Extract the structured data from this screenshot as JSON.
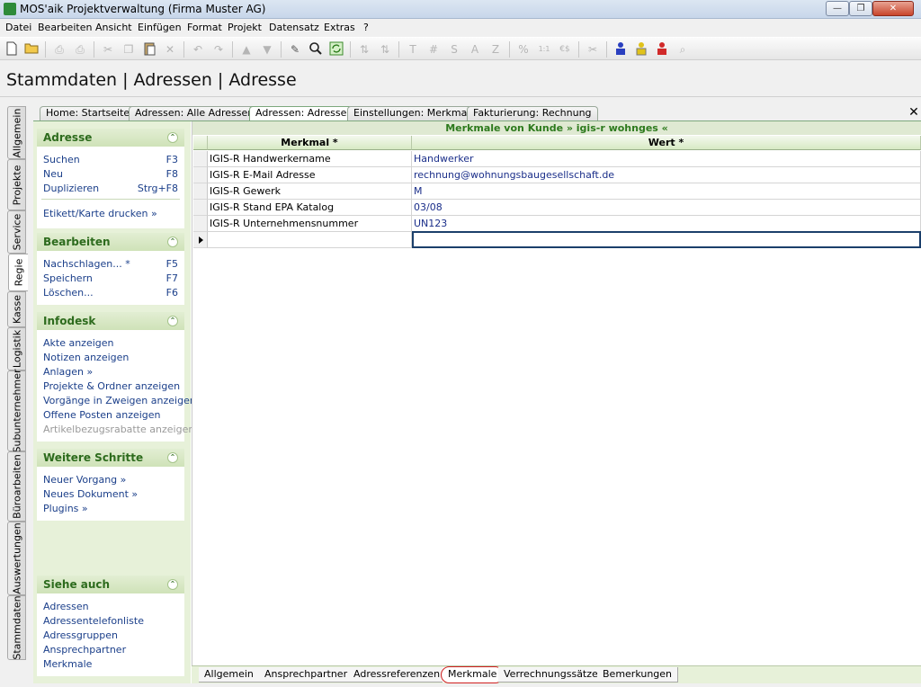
{
  "window": {
    "title": "MOS'aik Projektverwaltung (Firma Muster AG)",
    "min_label": "—",
    "max_label": "❐",
    "close_label": "✕"
  },
  "menu": [
    "Datei",
    "Bearbeiten",
    "Ansicht",
    "Einfügen",
    "Format",
    "Projekt",
    "Datensatz",
    "Extras",
    "?"
  ],
  "toolbar": {
    "text_buttons": {
      "t": "T",
      "hash": "#",
      "s": "S",
      "a": "A",
      "z": "Z",
      "percent": "%",
      "euro": "€$",
      "ratio": "1:1"
    }
  },
  "page_title": "Stammdaten | Adressen | Adresse",
  "vertical_tabs": [
    "Allgemein",
    "Projekte",
    "Service",
    "Regie",
    "Kasse",
    "Logistik",
    "Subunternehmer",
    "Büroarbeiten",
    "Auswertungen",
    "Stammdaten"
  ],
  "doc_tabs": [
    "Home: Startseite",
    "Adressen: Alle Adressen",
    "Adressen: Adresse",
    "Einstellungen: Merkmale",
    "Fakturierung: Rechnung"
  ],
  "doc_close": "✕",
  "taskpane": {
    "collapse_glyph": "⌃",
    "adresse": {
      "title": "Adresse",
      "items": [
        {
          "label": "Suchen",
          "key": "F3"
        },
        {
          "label": "Neu",
          "key": "F8"
        },
        {
          "label": "Duplizieren",
          "key": "Strg+F8"
        }
      ],
      "extra": "Etikett/Karte drucken »"
    },
    "bearbeiten": {
      "title": "Bearbeiten",
      "items": [
        {
          "label": "Nachschlagen... *",
          "key": "F5"
        },
        {
          "label": "Speichern",
          "key": "F7"
        },
        {
          "label": "Löschen...",
          "key": "F6"
        }
      ]
    },
    "infodesk": {
      "title": "Infodesk",
      "items": [
        "Akte anzeigen",
        "Notizen anzeigen",
        "Anlagen »",
        "Projekte & Ordner anzeigen",
        "Vorgänge in Zweigen anzeigen",
        "Offene Posten anzeigen",
        "Artikelbezugsrabatte anzeigen"
      ]
    },
    "weitere": {
      "title": "Weitere Schritte",
      "items": [
        "Neuer Vorgang »",
        "Neues Dokument »",
        "Plugins »"
      ]
    },
    "siehe": {
      "title": "Siehe auch",
      "items": [
        "Adressen",
        "Adressentelefonliste",
        "Adressgruppen",
        "Ansprechpartner",
        "Merkmale"
      ]
    }
  },
  "grid": {
    "caption": "Merkmale von Kunde » igis-r wohnges «",
    "col_merkmal": "Merkmal *",
    "col_wert": "Wert *",
    "rows": [
      {
        "merkmal": "IGIS-R Handwerkername",
        "wert": "Handwerker"
      },
      {
        "merkmal": "IGIS-R E-Mail Adresse",
        "wert": "rechnung@wohnungsbaugesellschaft.de"
      },
      {
        "merkmal": "IGIS-R Gewerk",
        "wert": "M"
      },
      {
        "merkmal": "IGIS-R Stand EPA Katalog",
        "wert": "03/08"
      },
      {
        "merkmal": "IGIS-R Unternehmensnummer",
        "wert": "UN123"
      }
    ]
  },
  "bottom_tabs": [
    "Allgemein",
    "Ansprechpartner",
    "Adressreferenzen",
    "Merkmale",
    "Verrechnungssätze",
    "Bemerkungen"
  ]
}
